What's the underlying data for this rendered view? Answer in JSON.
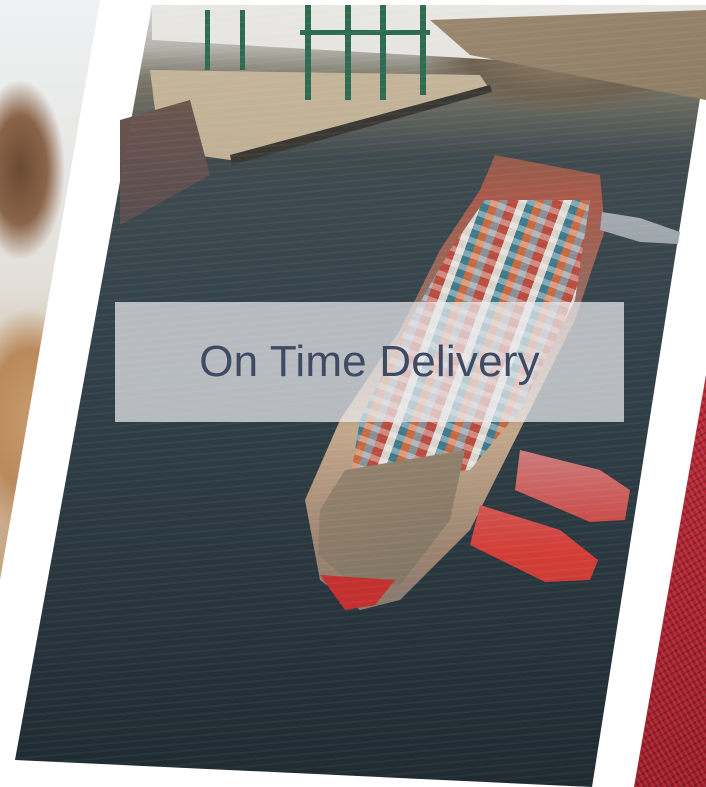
{
  "slide": {
    "caption": "On Time Delivery"
  },
  "images": {
    "left": "person-photo",
    "center": "container-ship-aerial-photo",
    "right": "red-fabric-photo"
  },
  "colors": {
    "caption_text": "#3f4a63",
    "caption_band": "#ececee",
    "accent_red": "#c62c39"
  }
}
